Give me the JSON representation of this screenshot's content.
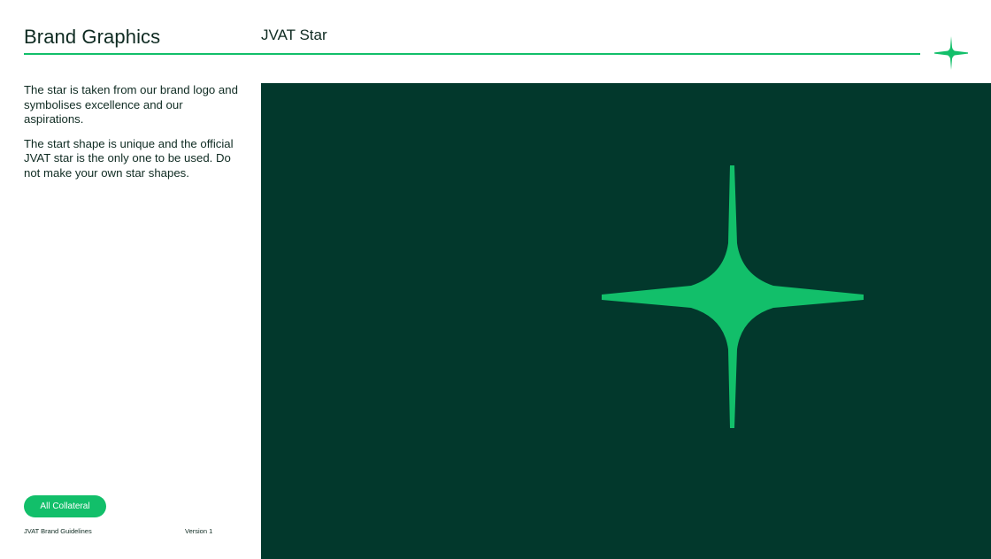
{
  "header": {
    "section_title": "Brand Graphics",
    "page_title": "JVAT Star"
  },
  "intro": {
    "paragraphs": [
      "The star is taken from our brand logo and symbolises excellence and our aspirations.",
      "The start shape is unique and the official JVAT star is the only one to be used. Do not make your own star shapes."
    ]
  },
  "footer": {
    "button_label": "All Collateral",
    "doc_name": "JVAT Brand Guidelines",
    "version": "Version 1"
  },
  "colors": {
    "accent_green": "#12bf6a",
    "panel_dark_green": "#02382c",
    "text": "#0f2b22"
  },
  "icons": {
    "corner": "star-icon",
    "hero": "jvat-star-graphic"
  }
}
